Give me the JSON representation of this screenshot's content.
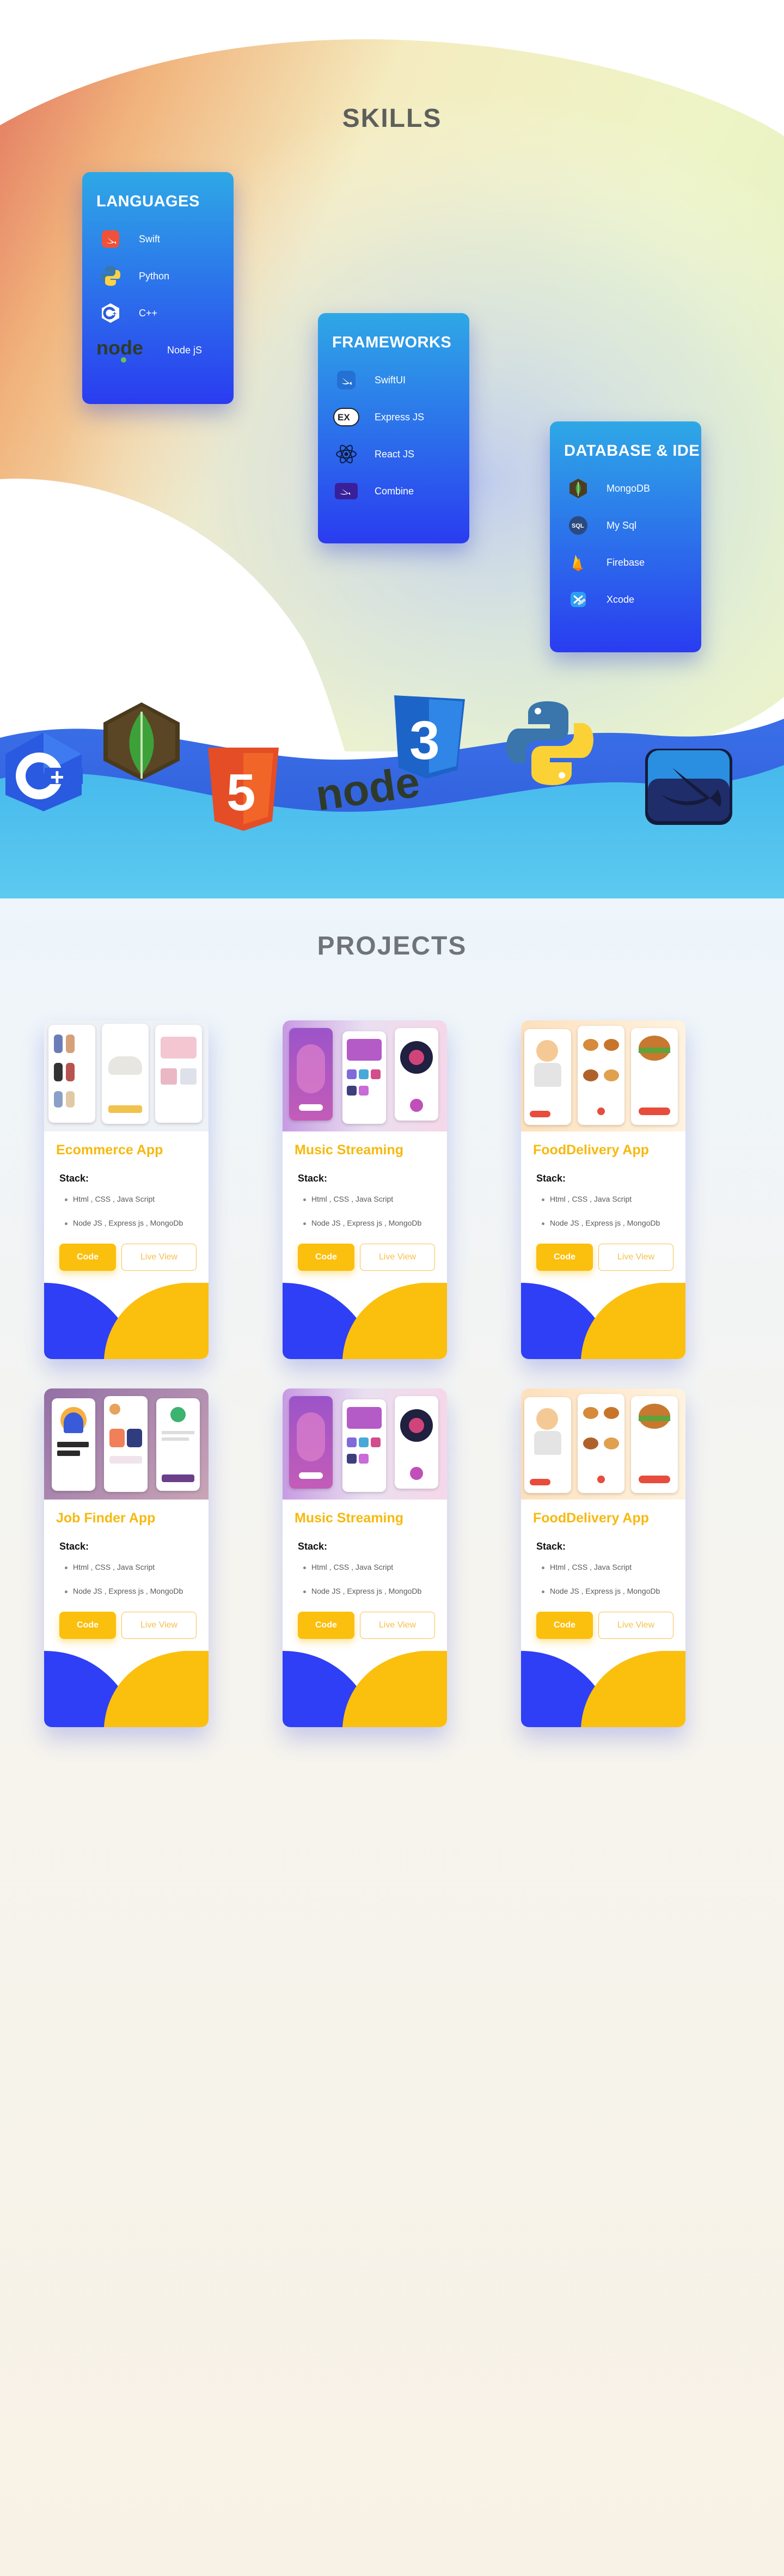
{
  "skills": {
    "title": "SKILLS",
    "cards": [
      {
        "title": "LANGUAGES",
        "items": [
          {
            "label": "Swift",
            "icon": "swift-icon"
          },
          {
            "label": "Python",
            "icon": "python-icon"
          },
          {
            "label": "C++",
            "icon": "cpp-icon"
          },
          {
            "label": "Node jS",
            "icon": "nodejs-icon"
          }
        ]
      },
      {
        "title": "FRAMEWORKS",
        "items": [
          {
            "label": "SwiftUI",
            "icon": "swiftui-icon"
          },
          {
            "label": "Express JS",
            "icon": "express-icon"
          },
          {
            "label": "React JS",
            "icon": "react-icon"
          },
          {
            "label": "Combine",
            "icon": "combine-icon"
          }
        ]
      },
      {
        "title": "DATABASE & IDE",
        "items": [
          {
            "label": "MongoDB",
            "icon": "mongodb-icon"
          },
          {
            "label": "My Sql",
            "icon": "mysql-icon"
          },
          {
            "label": "Firebase",
            "icon": "firebase-icon"
          },
          {
            "label": "Xcode",
            "icon": "xcode-icon"
          }
        ]
      }
    ],
    "wave_logos": [
      "cpp-icon",
      "mongodb-icon",
      "html5-icon",
      "nodejs-icon",
      "css3-icon",
      "python-icon",
      "swift-icon"
    ],
    "logo_text": {
      "node": "node",
      "html": "5",
      "css": "3"
    }
  },
  "projects": {
    "title": "PROJECTS",
    "stack_label": "Stack:",
    "code_label": "Code",
    "live_label": "Live View",
    "cards": [
      {
        "title": "Ecommerce App",
        "line1": "Html , CSS , Java Script",
        "line2": "Node JS , Express js , MongoDb",
        "thumb": "ecommerce"
      },
      {
        "title": "Music Streaming",
        "line1": "Html , CSS , Java Script",
        "line2": "Node JS , Express js , MongoDb",
        "thumb": "music"
      },
      {
        "title": "FoodDelivery App",
        "line1": "Html , CSS , Java Script",
        "line2": "Node JS , Express js , MongoDb",
        "thumb": "food"
      },
      {
        "title": "Job Finder App",
        "line1": "Html , CSS , Java Script",
        "line2": "Node JS , Express js , MongoDb",
        "thumb": "job"
      },
      {
        "title": "Music Streaming",
        "line1": "Html , CSS , Java Script",
        "line2": "Node JS , Express js , MongoDb",
        "thumb": "music"
      },
      {
        "title": "FoodDelivery App",
        "line1": "Html , CSS , Java Script",
        "line2": "Node JS , Express js , MongoDb",
        "thumb": "food"
      }
    ]
  },
  "colors": {
    "accent_yellow": "#fbbf0e",
    "accent_blue": "#2a3cf0",
    "card_gradient_top": "#2ea8e6",
    "title_gray": "#5d5f5c"
  }
}
